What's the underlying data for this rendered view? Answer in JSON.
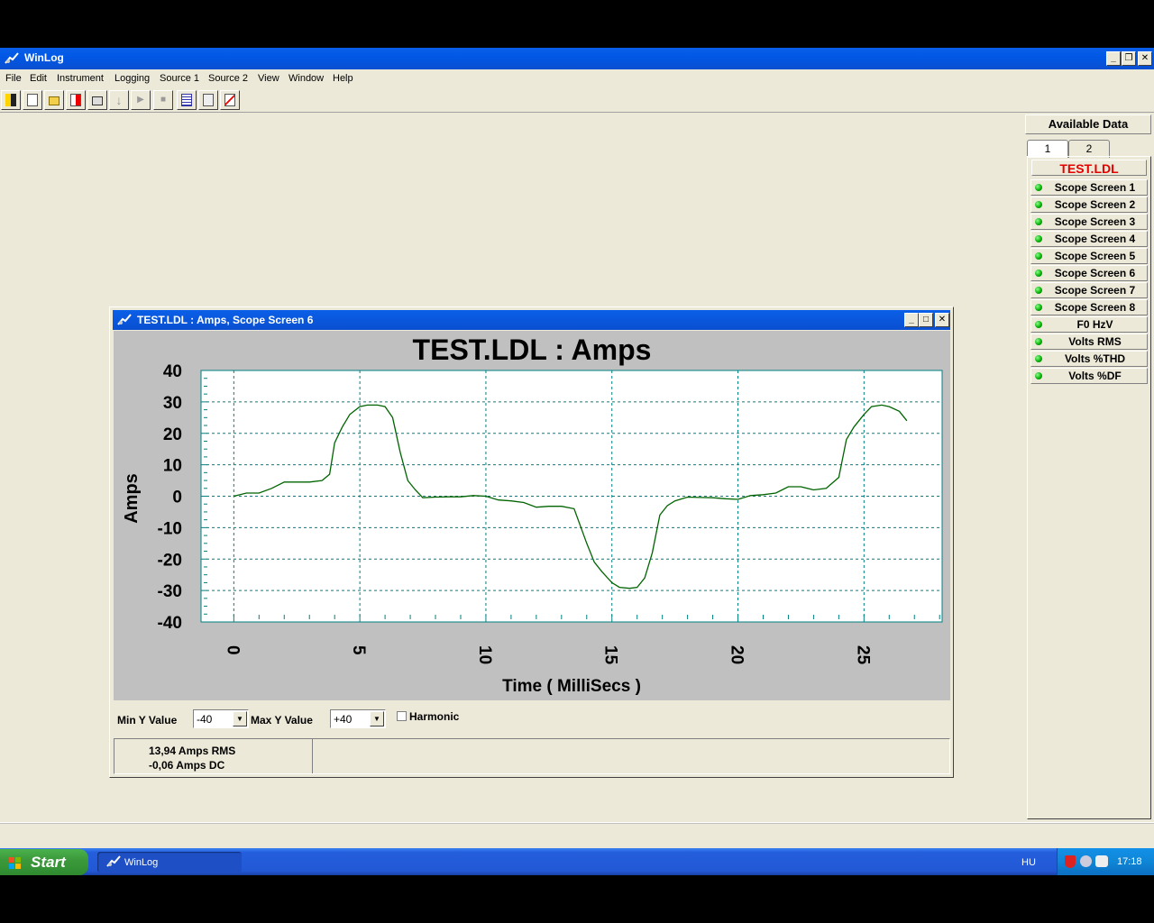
{
  "app": {
    "title": "WinLog",
    "menu": [
      "File",
      "Edit",
      "Instrument",
      "Logging",
      "Source 1",
      "Source 2",
      "View",
      "Window",
      "Help"
    ],
    "toolbar_icons": [
      "exit-icon",
      "new-file-icon",
      "open-folder-icon",
      "export-icon",
      "print-icon",
      "download-icon",
      "play-icon",
      "stop-icon",
      "table-icon",
      "monitor-icon",
      "chart-icon"
    ]
  },
  "available_data": {
    "title": "Available Data",
    "tabs": [
      "1",
      "2"
    ],
    "file": "TEST.LDL",
    "items": [
      "Scope Screen 1",
      "Scope Screen 2",
      "Scope Screen 3",
      "Scope Screen 4",
      "Scope Screen 5",
      "Scope Screen 6",
      "Scope Screen 7",
      "Scope Screen 8",
      "F0 HzV",
      "Volts RMS",
      "Volts %THD",
      "Volts %DF"
    ]
  },
  "child_window": {
    "title": "TEST.LDL : Amps, Scope Screen 6",
    "min_y_label": "Min Y Value",
    "min_y_value": "-40",
    "max_y_label": "Max Y Value",
    "max_y_value": "+40",
    "harmonic_label": "Harmonic",
    "rms": "13,94 Amps RMS",
    "dc": "-0,06 Amps DC"
  },
  "chart_data": {
    "type": "line",
    "title": "TEST.LDL : Amps",
    "xlabel": "Time ( MilliSecs )",
    "ylabel": "Amps",
    "xlim": [
      -1.3,
      28.1
    ],
    "ylim": [
      -40,
      40
    ],
    "x_ticks": [
      0,
      5,
      10,
      15,
      20,
      25
    ],
    "y_ticks": [
      40,
      30,
      20,
      10,
      0,
      -10,
      -20,
      -30,
      -40
    ],
    "grid": true,
    "color": "#006400",
    "series": [
      {
        "x": [
          0,
          0.5,
          1,
          1.5,
          2,
          2.5,
          3,
          3.5,
          3.8,
          4,
          4.3,
          4.6,
          5,
          5.3,
          5.7,
          6,
          6.3,
          6.6,
          6.9,
          7.2,
          7.5,
          8,
          8.5,
          9,
          9.5,
          10,
          10.5,
          11,
          11.5,
          12,
          12.5,
          13,
          13.5,
          14,
          14.3,
          14.6,
          15,
          15.3,
          15.7,
          16,
          16.3,
          16.6,
          16.9,
          17.2,
          17.5,
          18,
          18.5,
          19,
          19.5,
          20,
          20.5,
          21,
          21.5,
          22,
          22.5,
          23,
          23.5,
          24,
          24.3,
          24.6,
          25,
          25.3,
          25.7,
          26,
          26.4,
          26.7
        ],
        "y": [
          0,
          1,
          1,
          2.5,
          4.5,
          4.5,
          4.5,
          5,
          7,
          17,
          22,
          26,
          28.5,
          29,
          29,
          28.5,
          25,
          14,
          5,
          2,
          -0.5,
          -0.3,
          -0.2,
          -0.2,
          0.2,
          0,
          -1.2,
          -1.5,
          -2,
          -3.5,
          -3.2,
          -3.2,
          -4,
          -15,
          -21,
          -24,
          -27.5,
          -29,
          -29.3,
          -29,
          -26,
          -18,
          -6,
          -3,
          -1.5,
          -0.3,
          -0.4,
          -0.5,
          -0.8,
          -1,
          0.2,
          0.5,
          1,
          3,
          3,
          2,
          2.5,
          6,
          18,
          22,
          26,
          28.5,
          29,
          28.5,
          27,
          24
        ]
      }
    ]
  },
  "taskbar": {
    "start_label": "Start",
    "task_label": "WinLog",
    "language": "HU",
    "time": "17:18"
  },
  "colors": {
    "titlebar": "#0a4fd0",
    "file_header": "#e60000",
    "plot_bg": "#ffffff",
    "chart_bg": "#c0c0c0",
    "grid": "#008080"
  }
}
